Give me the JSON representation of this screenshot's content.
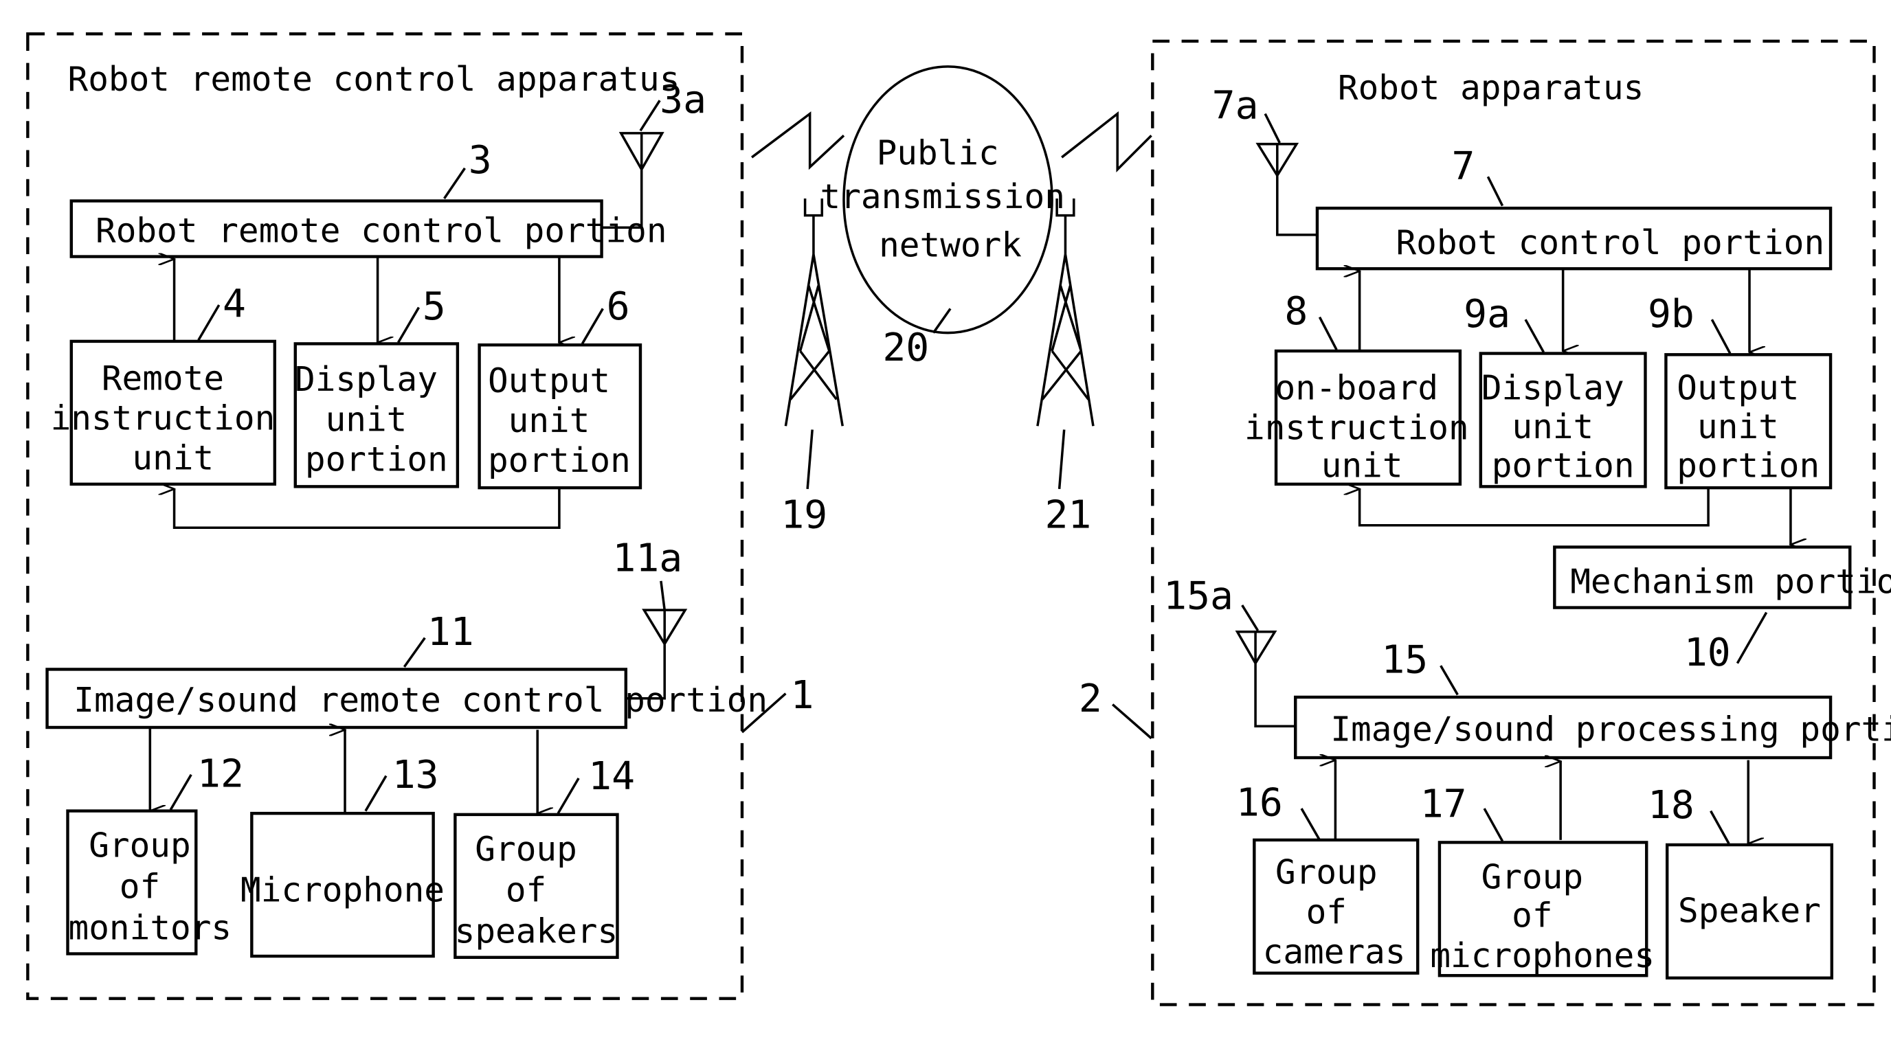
{
  "diagram": {
    "left_group": {
      "ref": "1",
      "title": "Robot remote control apparatus",
      "control": {
        "ref": "3",
        "antenna_ref": "3a",
        "label": "Robot remote control portion"
      },
      "units": [
        {
          "ref": "4",
          "lines": [
            "Remote",
            "instruction",
            "unit"
          ]
        },
        {
          "ref": "5",
          "lines": [
            "Display",
            "unit",
            "portion"
          ]
        },
        {
          "ref": "6",
          "lines": [
            "Output",
            "unit",
            "portion"
          ]
        }
      ],
      "av_control": {
        "ref": "11",
        "antenna_ref": "11a",
        "label": "Image/sound remote control portion"
      },
      "av_units": [
        {
          "ref": "12",
          "lines": [
            "Group",
            "of",
            "monitors"
          ]
        },
        {
          "ref": "13",
          "lines": [
            "Microphone"
          ]
        },
        {
          "ref": "14",
          "lines": [
            "Group",
            "of",
            "speakers"
          ]
        }
      ]
    },
    "network": {
      "ref": "20",
      "lines": [
        "Public",
        "transmission",
        "network"
      ],
      "towers": [
        {
          "ref": "19"
        },
        {
          "ref": "21"
        }
      ]
    },
    "right_group": {
      "ref": "2",
      "title": "Robot apparatus",
      "control": {
        "ref": "7",
        "antenna_ref": "7a",
        "label": "Robot control portion"
      },
      "units": [
        {
          "ref": "8",
          "lines": [
            "on-board",
            "instruction",
            "unit"
          ]
        },
        {
          "ref": "9a",
          "lines": [
            "Display",
            "unit",
            "portion"
          ]
        },
        {
          "ref": "9b",
          "lines": [
            "Output",
            "unit",
            "portion"
          ]
        }
      ],
      "mechanism": {
        "ref": "10",
        "label": "Mechanism portion"
      },
      "av_control": {
        "ref": "15",
        "antenna_ref": "15a",
        "label": "Image/sound processing portion"
      },
      "av_units": [
        {
          "ref": "16",
          "lines": [
            "Group",
            "of",
            "cameras"
          ]
        },
        {
          "ref": "17",
          "lines": [
            "Group",
            "of",
            "microphones"
          ]
        },
        {
          "ref": "18",
          "lines": [
            "Speaker"
          ]
        }
      ]
    }
  }
}
